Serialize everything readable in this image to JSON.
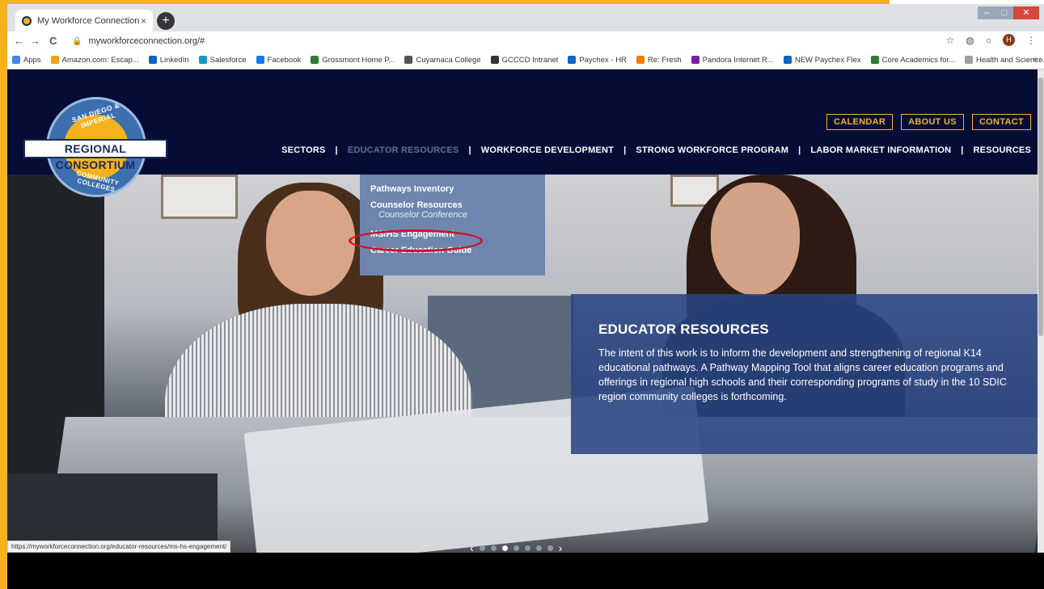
{
  "browser": {
    "tab_title": "My Workforce Connection",
    "tab_close": "×",
    "new_tab": "+",
    "url": "myworkforceconnection.org/#",
    "back": "←",
    "forward": "→",
    "reload": "C",
    "avatar_letter": "H",
    "bookmarks": [
      {
        "label": "Apps",
        "color": "#4285f4"
      },
      {
        "label": "Amazon.com: Escap...",
        "color": "#f0a21a"
      },
      {
        "label": "LinkedIn",
        "color": "#0a66c2"
      },
      {
        "label": "Salesforce",
        "color": "#1798c1"
      },
      {
        "label": "Facebook",
        "color": "#1877f2"
      },
      {
        "label": "Grossmont Home P...",
        "color": "#2e7d32"
      },
      {
        "label": "Cuyamaca College",
        "color": "#555555"
      },
      {
        "label": "GCCCD Intranet",
        "color": "#333333"
      },
      {
        "label": "Paychex - HR",
        "color": "#1565c0"
      },
      {
        "label": "Re: Fresh",
        "color": "#f57c00"
      },
      {
        "label": "Pandora Internet R...",
        "color": "#7b1fa2"
      },
      {
        "label": "NEW Paychex Flex",
        "color": "#1565c0"
      },
      {
        "label": "Core Academics for...",
        "color": "#2e7d32"
      },
      {
        "label": "Health and Science...",
        "color": "#9e9e9e"
      }
    ],
    "bookmarks_more": "»",
    "status_url": "https://myworkforceconnection.org/educator-resources/ms-hs-engagement/"
  },
  "logo": {
    "arc_top": "SAN DIEGO & IMPERIAL",
    "banner": "REGIONAL CONSORTIUM",
    "arc_bottom": "COMMUNITY COLLEGES"
  },
  "util_nav": [
    "CALENDAR",
    "ABOUT US",
    "CONTACT"
  ],
  "main_nav": {
    "sectors": "SECTORS",
    "educator_resources": "EDUCATOR RESOURCES",
    "workforce_development": "WORKFORCE DEVELOPMENT",
    "strong_workforce": "STRONG WORKFORCE PROGRAM",
    "labor_market": "LABOR MARKET INFORMATION",
    "resources": "RESOURCES",
    "separator": "|"
  },
  "dropdown": {
    "pathways_inventory": "Pathways Inventory",
    "counselor_resources": "Counselor Resources",
    "counselor_conference": "Counselor Conference",
    "ms_hs_engagement": "MS/HS Engagement",
    "career_education_guide": "Career Education Guide"
  },
  "info": {
    "title": "EDUCATOR RESOURCES",
    "text": "The intent of this work is to inform the development and strengthening of regional K14 educational pathways. A Pathway Mapping Tool that aligns career education programs and offerings in regional high schools and their corresponding programs of study in the 10 SDIC region community colleges is forthcoming."
  },
  "carousel": {
    "prev": "‹",
    "next": "›",
    "dot_count": 7,
    "active_index": 2
  },
  "colors": {
    "accent": "#f5b21d",
    "nav_bg": "#050d36",
    "dropdown_bg": "#6e86ad",
    "highlight": "#d0102a"
  }
}
